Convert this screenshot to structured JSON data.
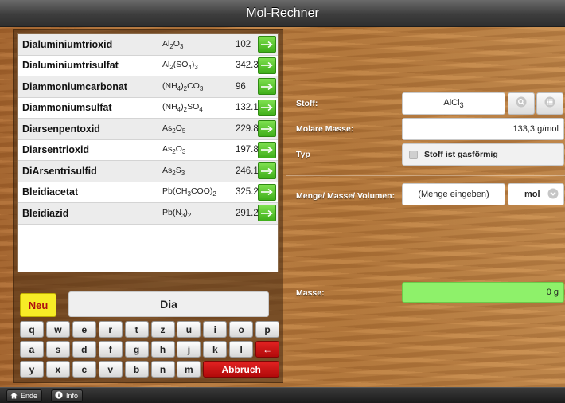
{
  "app": {
    "title": "Mol-Rechner"
  },
  "list": {
    "items": [
      {
        "name": "Dialuminiumtrioxid",
        "formula_parts": [
          [
            "Al",
            ""
          ],
          [
            "2",
            "sub"
          ],
          [
            "O",
            ""
          ],
          [
            "3",
            "sub"
          ]
        ],
        "mass": "102"
      },
      {
        "name": "Dialuminiumtrisulfat",
        "formula_parts": [
          [
            "Al",
            ""
          ],
          [
            "2",
            "sub"
          ],
          [
            "(SO",
            ""
          ],
          [
            "4",
            "sub"
          ],
          [
            ")",
            ""
          ],
          [
            "3",
            "sub"
          ]
        ],
        "mass": "342.3"
      },
      {
        "name": "Diammoniumcarbonat",
        "formula_parts": [
          [
            "(NH",
            ""
          ],
          [
            "4",
            "sub"
          ],
          [
            ")",
            ""
          ],
          [
            "2",
            "sub"
          ],
          [
            "CO",
            ""
          ],
          [
            "3",
            "sub"
          ]
        ],
        "mass": "96"
      },
      {
        "name": "Diammoniumsulfat",
        "formula_parts": [
          [
            "(NH",
            ""
          ],
          [
            "4",
            "sub"
          ],
          [
            ")",
            ""
          ],
          [
            "2",
            "sub"
          ],
          [
            "SO",
            ""
          ],
          [
            "4",
            "sub"
          ]
        ],
        "mass": "132.1"
      },
      {
        "name": "Diarsenpentoxid",
        "formula_parts": [
          [
            "As",
            ""
          ],
          [
            "2",
            "sub"
          ],
          [
            "O",
            ""
          ],
          [
            "5",
            "sub"
          ]
        ],
        "mass": "229.8"
      },
      {
        "name": "Diarsentrioxid",
        "formula_parts": [
          [
            "As",
            ""
          ],
          [
            "2",
            "sub"
          ],
          [
            "O",
            ""
          ],
          [
            "3",
            "sub"
          ]
        ],
        "mass": "197.8"
      },
      {
        "name": "DiArsentrisulfid",
        "formula_parts": [
          [
            "As",
            ""
          ],
          [
            "2",
            "sub"
          ],
          [
            "S",
            ""
          ],
          [
            "3",
            "sub"
          ]
        ],
        "mass": "246.1"
      },
      {
        "name": "Bleidiacetat",
        "formula_parts": [
          [
            "Pb(CH",
            ""
          ],
          [
            "3",
            "sub"
          ],
          [
            "COO)",
            ""
          ],
          [
            "2",
            "sub"
          ]
        ],
        "mass": "325.2"
      },
      {
        "name": "Bleidiazid",
        "formula_parts": [
          [
            "Pb(N",
            ""
          ],
          [
            "3",
            "sub"
          ],
          [
            ")",
            ""
          ],
          [
            "2",
            "sub"
          ]
        ],
        "mass": "291.2"
      }
    ]
  },
  "search": {
    "new_label": "Neu",
    "value": "Dia"
  },
  "keyboard": {
    "row1": [
      "q",
      "w",
      "e",
      "r",
      "t",
      "z",
      "u",
      "i",
      "o",
      "p"
    ],
    "row2": [
      "a",
      "s",
      "d",
      "f",
      "g",
      "h",
      "j",
      "k",
      "l"
    ],
    "row3": [
      "y",
      "x",
      "c",
      "v",
      "b",
      "n",
      "m"
    ],
    "backspace": "←",
    "cancel": "Abbruch"
  },
  "form": {
    "stoff_label": "Stoff:",
    "stoff_parts": [
      [
        "AlCl",
        ""
      ],
      [
        "3",
        "sub"
      ]
    ],
    "molare_label": "Molare Masse:",
    "molare_value": "133,3 g/mol",
    "typ_label": "Typ",
    "gas_label": "Stoff ist gasförmig",
    "menge_label": "Menge/ Masse/ Volumen:",
    "menge_placeholder": "(Menge eingeben)",
    "unit_value": "mol",
    "masse_label": "Masse:",
    "masse_value": "0 g"
  },
  "bottom": {
    "ende_label": "Ende",
    "info_label": "Info"
  },
  "colors": {
    "accent_green": "#8ef16a",
    "arrow_green": "#4cc21f",
    "cancel_red": "#cc1111",
    "neu_yellow": "#f7ec26"
  },
  "icons": [
    "arrow-right-icon",
    "search-icon",
    "grid-icon",
    "chevron-down-icon",
    "home-icon",
    "info-icon",
    "backspace-icon"
  ]
}
